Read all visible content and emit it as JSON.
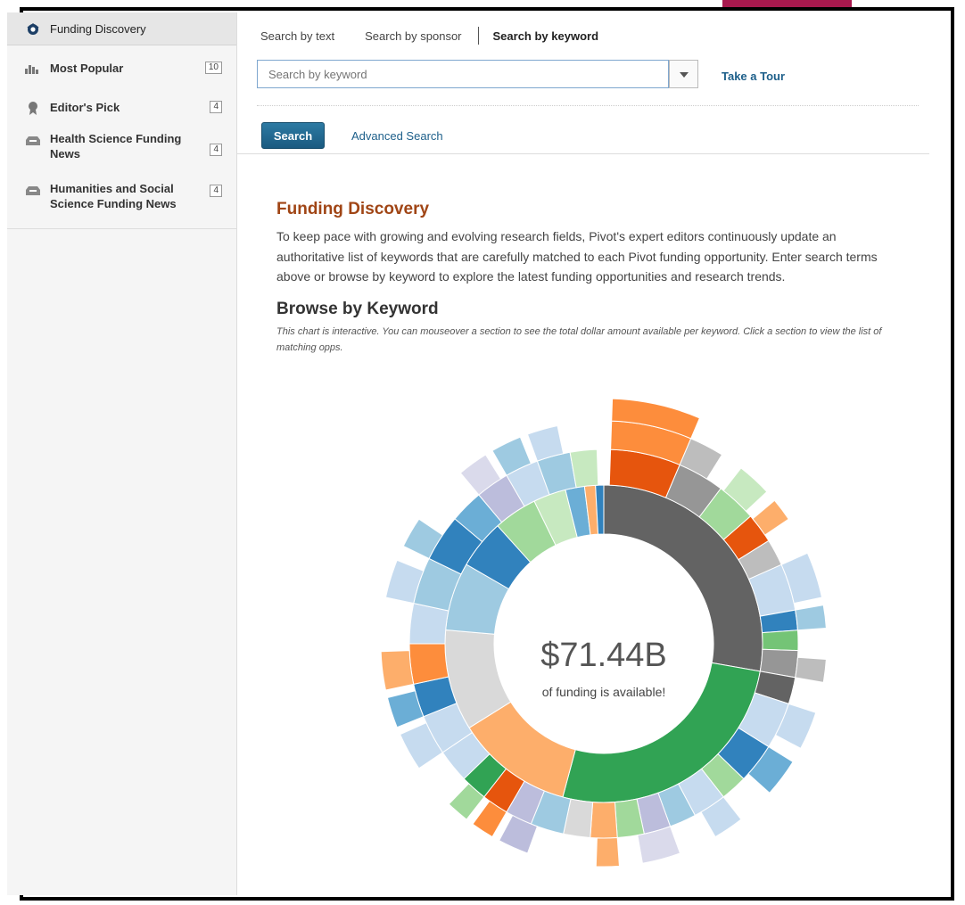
{
  "sidebar": {
    "header": {
      "label": "Funding Discovery",
      "icon": "eye-icon"
    },
    "items": [
      {
        "label": "Most Popular",
        "count": "10",
        "icon": "bar-chart-icon"
      },
      {
        "label": "Editor's Pick",
        "count": "4",
        "icon": "award-ribbon-icon"
      },
      {
        "label": "Health Science Funding News",
        "count": "4",
        "icon": "inbox-tray-icon"
      },
      {
        "label": "Humanities and Social Science Funding News",
        "count": "4",
        "icon": "inbox-tray-icon"
      }
    ]
  },
  "search": {
    "tabs": [
      "Search by text",
      "Search by sponsor",
      "Search by keyword"
    ],
    "active_tab": "Search by keyword",
    "placeholder": "Search by keyword",
    "value": "",
    "tour_link": "Take a Tour",
    "search_button": "Search",
    "advanced_link": "Advanced Search"
  },
  "main": {
    "title": "Funding Discovery",
    "description": "To keep pace with growing and evolving research fields, Pivot's expert editors continuously update an authoritative list of keywords that are carefully matched to each Pivot funding opportunity. Enter search terms above or browse by keyword to explore the latest funding opportunities and research trends.",
    "browse_title": "Browse by Keyword",
    "browse_note": "This chart is interactive. You can mouseover a section to see the total dollar amount available per keyword. Click a section to view the list of matching opps.",
    "center_value": "$71.44B",
    "center_label": "of funding is available!"
  },
  "colors": {
    "accent": "#a8194e",
    "title_orange": "#a04515",
    "link_blue": "#1d5f8a",
    "button_blue": "#1a5a80"
  }
}
